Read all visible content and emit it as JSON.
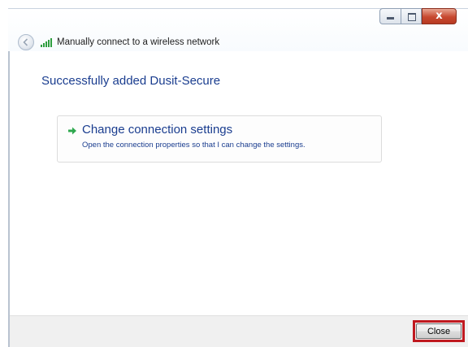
{
  "window": {
    "title": "Manually connect to a wireless network",
    "caption_buttons": {
      "minimize_icon": "minimize-icon",
      "maximize_icon": "maximize-icon",
      "close_symbol": "x"
    }
  },
  "content": {
    "heading": "Successfully added Dusit-Secure",
    "command_link": {
      "title": "Change connection settings",
      "description": "Open the connection properties so that I can change the settings.",
      "icon": "green-arrow-icon"
    }
  },
  "footer": {
    "close_label": "Close"
  },
  "colors": {
    "heading": "#1a3d8f",
    "highlight_border": "#c0191f",
    "footer_bg": "#f0f0f0",
    "arrow": "#2fa84f"
  }
}
